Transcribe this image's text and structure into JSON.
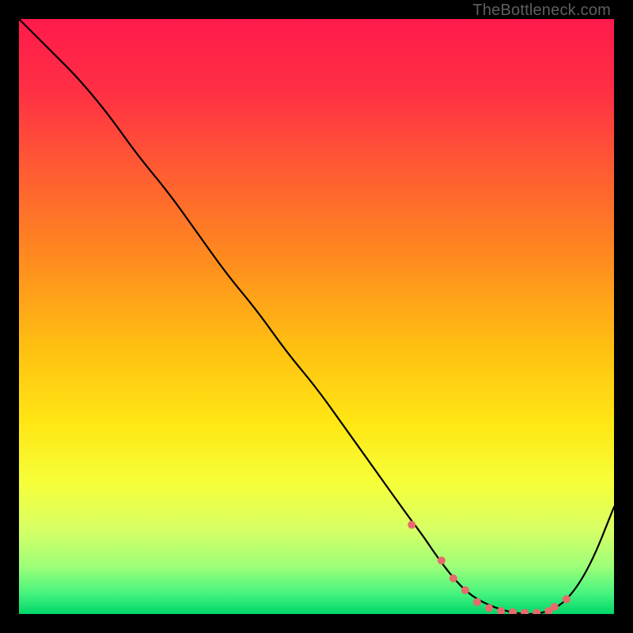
{
  "watermark": "TheBottleneck.com",
  "chart_data": {
    "type": "line",
    "title": "",
    "xlabel": "",
    "ylabel": "",
    "xlim": [
      0,
      100
    ],
    "ylim": [
      0,
      100
    ],
    "grid": false,
    "legend": false,
    "series": [
      {
        "name": "bottleneck-curve",
        "x": [
          0,
          3,
          6,
          10,
          15,
          20,
          25,
          30,
          35,
          40,
          45,
          50,
          55,
          60,
          65,
          68,
          70,
          73,
          76,
          80,
          84,
          88,
          92,
          96,
          100
        ],
        "y": [
          100,
          97,
          94,
          90,
          84,
          77,
          71,
          64,
          57,
          51,
          44,
          38,
          31,
          24,
          17,
          13,
          10,
          6,
          3,
          1,
          0,
          0,
          2,
          8,
          18
        ]
      }
    ],
    "markers": {
      "name": "highlight-dots",
      "x": [
        66,
        71,
        73,
        75,
        77,
        79,
        81,
        83,
        85,
        87,
        89,
        90,
        92
      ],
      "y": [
        15,
        9,
        6,
        4,
        2,
        1,
        0.5,
        0.3,
        0.2,
        0.2,
        0.5,
        1.2,
        2.5
      ]
    },
    "gradient_stops": [
      {
        "offset": 0.0,
        "color": "#ff1a4b"
      },
      {
        "offset": 0.12,
        "color": "#ff2f44"
      },
      {
        "offset": 0.25,
        "color": "#ff5a33"
      },
      {
        "offset": 0.4,
        "color": "#ff8a1f"
      },
      {
        "offset": 0.55,
        "color": "#ffbf12"
      },
      {
        "offset": 0.68,
        "color": "#ffe714"
      },
      {
        "offset": 0.78,
        "color": "#f6ff3a"
      },
      {
        "offset": 0.86,
        "color": "#d6ff66"
      },
      {
        "offset": 0.92,
        "color": "#9dff78"
      },
      {
        "offset": 0.965,
        "color": "#47f47f"
      },
      {
        "offset": 1.0,
        "color": "#00d66a"
      }
    ]
  }
}
